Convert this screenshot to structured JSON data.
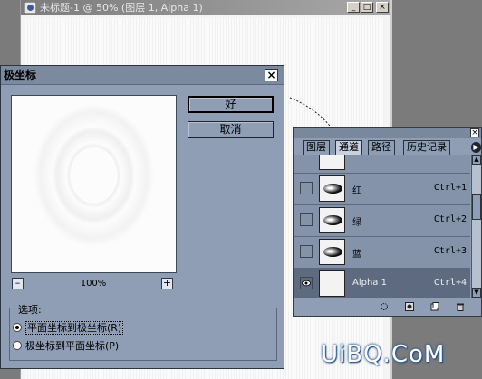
{
  "document_window": {
    "title": "未标题-1 @ 50% (图层 1, Alpha 1)",
    "buttons": [
      "_",
      "□",
      "×"
    ]
  },
  "dialog": {
    "title": "极坐标",
    "close_label": "×",
    "ok_label": "好",
    "cancel_label": "取消",
    "zoom_minus": "–",
    "zoom_plus": "+",
    "zoom_level": "100%",
    "options_label": "选项:",
    "options": [
      {
        "label": "平面坐标到极坐标(R)",
        "selected": true
      },
      {
        "label": "极坐标到平面坐标(P)",
        "selected": false
      }
    ]
  },
  "palette": {
    "close_label": "×",
    "tabs": [
      {
        "label": "图层",
        "active": false
      },
      {
        "label": "通道",
        "active": true
      },
      {
        "label": "路径",
        "active": false
      },
      {
        "label": "历史记录",
        "active": false
      }
    ],
    "channels": [
      {
        "name": "红",
        "shortcut": "Ctrl+1",
        "visible": false,
        "selected": false
      },
      {
        "name": "绿",
        "shortcut": "Ctrl+2",
        "visible": false,
        "selected": false
      },
      {
        "name": "蓝",
        "shortcut": "Ctrl+3",
        "visible": false,
        "selected": false
      },
      {
        "name": "Alpha 1",
        "shortcut": "Ctrl+4",
        "visible": true,
        "selected": true
      }
    ],
    "footer_icons": [
      "load-selection-icon",
      "save-selection-icon",
      "new-channel-icon",
      "trash-icon"
    ]
  },
  "watermark": "UiBQ.CoM",
  "colors": {
    "dialog_bg": "#8f9eb4",
    "selected_row": "#5d6a80",
    "workspace": "#7b7b7b"
  }
}
